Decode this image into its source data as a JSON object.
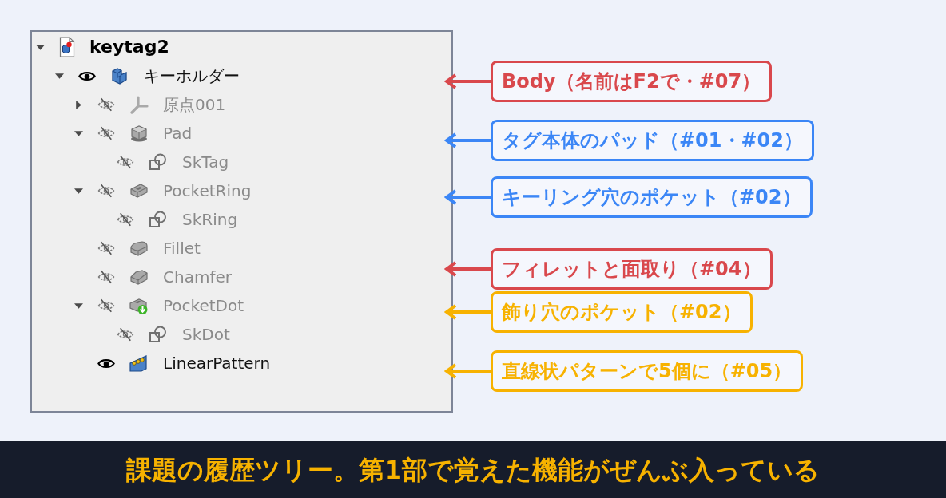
{
  "tree": {
    "items": [
      {
        "label": "keytag2",
        "kind": "document",
        "expanded": true,
        "children": [
          {
            "label": "キーホルダー",
            "kind": "body",
            "expanded": true,
            "visible": true,
            "children": [
              {
                "label": "原点001",
                "kind": "origin",
                "expanded": false,
                "visible": false
              },
              {
                "label": "Pad",
                "kind": "pad",
                "expanded": true,
                "visible": false,
                "children": [
                  {
                    "label": "SkTag",
                    "kind": "sketch",
                    "visible": false
                  }
                ]
              },
              {
                "label": "PocketRing",
                "kind": "pocket",
                "expanded": true,
                "visible": false,
                "children": [
                  {
                    "label": "SkRing",
                    "kind": "sketch",
                    "visible": false
                  }
                ]
              },
              {
                "label": "Fillet",
                "kind": "fillet",
                "visible": false
              },
              {
                "label": "Chamfer",
                "kind": "chamfer",
                "visible": false
              },
              {
                "label": "PocketDot",
                "kind": "pocket_hole",
                "expanded": true,
                "visible": false,
                "children": [
                  {
                    "label": "SkDot",
                    "kind": "sketch",
                    "visible": false
                  }
                ]
              },
              {
                "label": "LinearPattern",
                "kind": "linear_pattern",
                "visible": true
              }
            ]
          }
        ]
      }
    ]
  },
  "callouts": [
    {
      "text": "Body（名前はF2で・#07）",
      "color": "#d9484c"
    },
    {
      "text": "タグ本体のパッド（#01・#02）",
      "color": "#3b86f6"
    },
    {
      "text": "キーリング穴のポケット（#02）",
      "color": "#3b86f6"
    },
    {
      "text": "フィレットと面取り（#04）",
      "color": "#d9484c"
    },
    {
      "text": "飾り穴のポケット（#02）",
      "color": "#f7b200"
    },
    {
      "text": "直線状パターンで5個に（#05）",
      "color": "#f7b200"
    }
  ],
  "caption": {
    "text": "課題の履歴ツリー。第1部で覚えた機能がぜんぶ入っている"
  }
}
